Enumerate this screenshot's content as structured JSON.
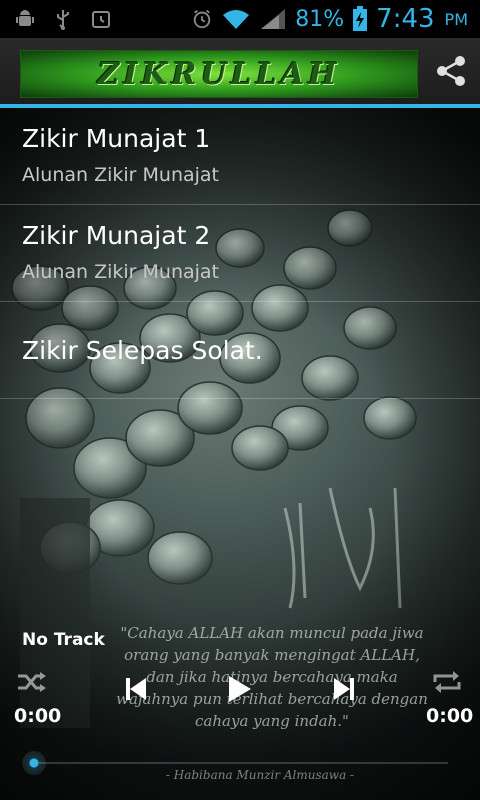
{
  "status_bar": {
    "battery_percent": "81%",
    "clock": "7:43",
    "ampm": "PM",
    "icons": [
      "android-debug-icon",
      "usb-icon",
      "alarm-icon",
      "alarm-clock-icon",
      "wifi-icon",
      "signal-icon",
      "battery-charging-icon"
    ]
  },
  "action_bar": {
    "banner_text": "ZIKRULLAH",
    "share_icon": "share-icon"
  },
  "list": [
    {
      "title": "Zikir Munajat 1",
      "subtitle": "Alunan Zikir Munajat"
    },
    {
      "title": "Zikir Munajat 2",
      "subtitle": "Alunan Zikir Munajat"
    },
    {
      "title": "Zikir Selepas Solat.",
      "subtitle": ""
    }
  ],
  "player": {
    "track_name": "No Track",
    "time_current": "0:00",
    "time_total": "0:00",
    "progress": 0,
    "controls": [
      "shuffle-icon",
      "previous-icon",
      "play-icon",
      "next-icon",
      "repeat-icon"
    ]
  },
  "background": {
    "quote": "\"Cahaya ALLAH akan muncul pada jiwa orang yang banyak mengingat ALLAH, dan jika hatinya bercahaya maka wajahnya pun terlihat bercahaya dengan cahaya yang indah.\"",
    "quote_author": "- Habibana Munzir Almusawa -"
  },
  "colors": {
    "accent": "#33b5e5",
    "banner_green": "#2f9a1e"
  }
}
